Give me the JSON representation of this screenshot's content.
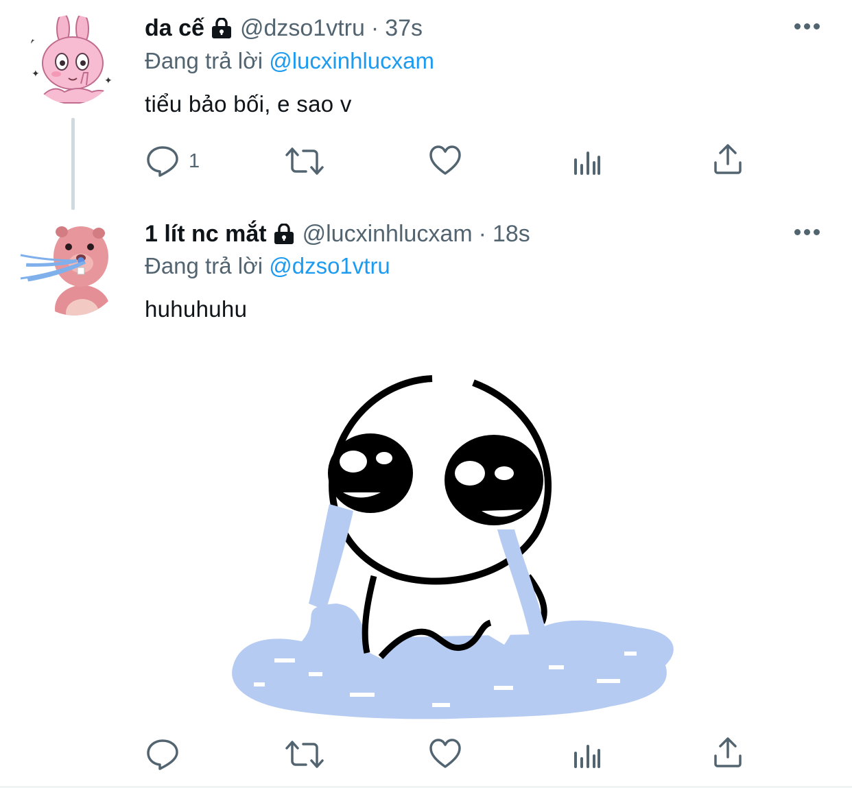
{
  "tweets": [
    {
      "display_name": "da cế",
      "handle": "@dzso1vtru",
      "separator": "·",
      "time": "37s",
      "replying_label": "Đang trả lời",
      "replying_to": "@lucxinhlucxam",
      "text": "tiểu bảo bối, e sao v",
      "avatar": "pink-bunny-avatar",
      "reply_count": "1"
    },
    {
      "display_name": "1 lít nc mắt",
      "handle": "@lucxinhlucxam",
      "separator": "·",
      "time": "18s",
      "replying_label": "Đang trả lời",
      "replying_to": "@dzso1vtru",
      "text": "huhuhuhu",
      "avatar": "pink-beaver-avatar",
      "reply_count": "",
      "media": "crying-doodle-image"
    }
  ],
  "icons": {
    "reply": "reply-icon",
    "retweet": "retweet-icon",
    "like": "heart-icon",
    "analytics": "analytics-icon",
    "share": "share-icon",
    "lock": "lock-icon",
    "more": "more-icon"
  },
  "colors": {
    "link": "#1d9bf0",
    "secondary_text": "#536471",
    "primary_text": "#0f1419",
    "tears": "#b3c9f1"
  }
}
